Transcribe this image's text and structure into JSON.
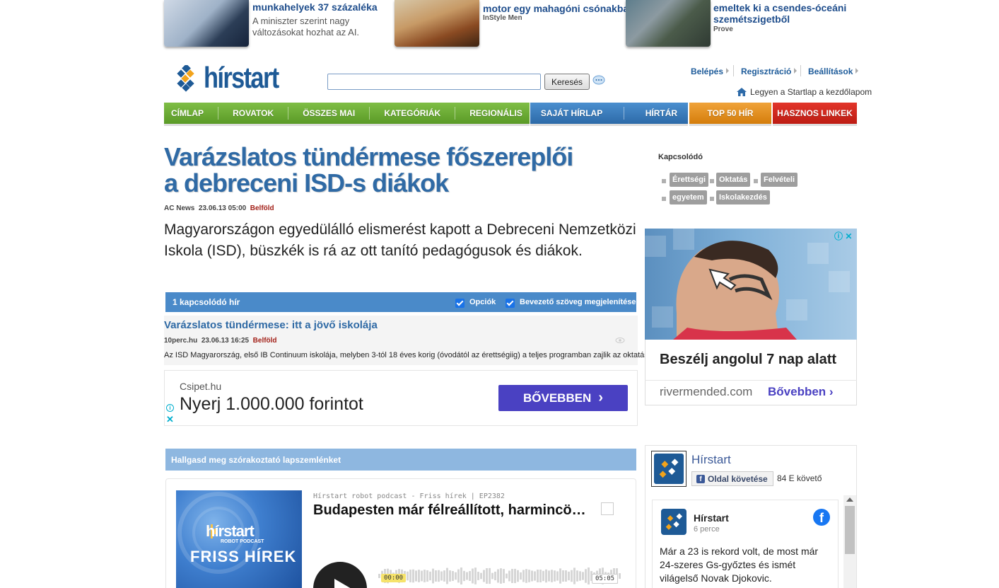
{
  "teasers": [
    {
      "title": "munkahelyek 37 százaléka",
      "lead": "A miniszter szerint nagy változásokat hozhat az AI.",
      "source": ""
    },
    {
      "title": "motor egy mahagóni csónakban",
      "source": "InStyle Men"
    },
    {
      "title_line1": "emeltek ki a csendes-óceáni",
      "title_line2": "szemétszigetből",
      "source": "Prove"
    }
  ],
  "header": {
    "logo": "hírstart",
    "search_placeholder": "",
    "search_button": "Keresés",
    "links": [
      "Belépés",
      "Regisztráció",
      "Beállítások"
    ],
    "home_text": "Legyen a Startlap a kezdőlapom"
  },
  "nav": {
    "green": [
      "CÍMLAP",
      "ROVATOK",
      "ÖSSZES MAI",
      "KATEGÓRIÁK",
      "REGIONÁLIS"
    ],
    "blue": [
      "SAJÁT HÍRLAP",
      "HÍRTÁR"
    ],
    "orange": "TOP 50 HÍR",
    "red": "HASZNOS LINKEK"
  },
  "article": {
    "headline": "Varázslatos tündérmese főszereplői a debreceni ISD-s diákok",
    "source": "AC News",
    "date": "23.06.13 05:00",
    "category": "Belföld",
    "lead": "Magyarországon egyedülálló elismerést kapott a Debreceni Nemzetközi Iskola (ISD), büszkék is rá az ott tanító pedagógusok és diákok."
  },
  "related": {
    "header": "1 kapcsolódó hír",
    "option1": "Opciók",
    "option2": "Bevezető szöveg megjelenítése",
    "item": {
      "title": "Varázslatos tündérmese: itt a jövő iskolája",
      "source": "10perc.hu",
      "date": "23.06.13 16:25",
      "category": "Belföld",
      "text": "Az ISD Magyarország, első IB Continuum iskolája, melyben 3-tól 18 éves korig (óvodától az érettségiig) a teljes programban zajlik az oktatás."
    }
  },
  "ad1": {
    "source": "Csipet.hu",
    "title": "Nyerj 1.000.000 forintot",
    "button": "BŐVEBBEN"
  },
  "podcast": {
    "bar": "Hallgasd meg szórakoztató lapszemlénket",
    "img_logo": "hírstart",
    "img_sub": "ROBOT PODCAST",
    "img_title": "FRISS HÍREK",
    "meta": "Hírstart robot podcast - Friss hírek | EP2382",
    "title": "Budapesten már félreállított, harmincö…",
    "time_current": "00:00",
    "time_total": "05:05"
  },
  "sidebar": {
    "related_title": "Kapcsolódó",
    "tags": [
      "Érettségi",
      "Oktatás",
      "Felvételi",
      "egyetem",
      "Iskolakezdés"
    ],
    "ad2": {
      "title": "Beszélj angolul 7 nap alatt",
      "domain": "rivermended.com",
      "more": "Bővebben"
    },
    "fb": {
      "name": "Hírstart",
      "follow": "Oldal követése",
      "count": "84 E követő",
      "post_name": "Hírstart",
      "post_time": "6 perce",
      "post_text": "Már a 23 is rekord volt, de most már 24-szeres Gs-győztes és ismét világelső Novak Djokovic."
    }
  }
}
